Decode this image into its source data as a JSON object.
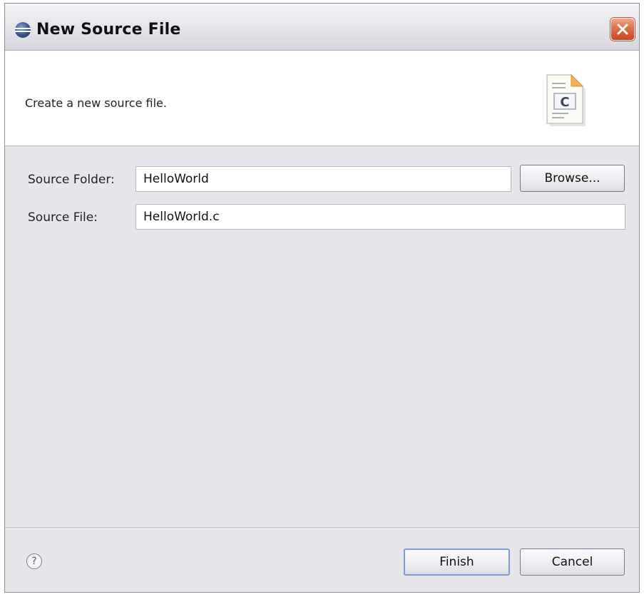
{
  "window": {
    "title": "New Source File",
    "app_icon": "eclipse-icon",
    "close_icon": "close-icon"
  },
  "banner": {
    "message": "Create a new source file.",
    "icon": "c-source-file-icon",
    "icon_letter": "C"
  },
  "form": {
    "source_folder": {
      "label": "Source Folder:",
      "value": "HelloWorld"
    },
    "source_file": {
      "label": "Source File:",
      "value": "HelloWorld.c"
    },
    "browse_label": "Browse..."
  },
  "footer": {
    "help_icon": "help-icon",
    "help_glyph": "?",
    "finish_label": "Finish",
    "cancel_label": "Cancel"
  },
  "colors": {
    "dialog_background": "#e8e6ea",
    "banner_background": "#ffffff",
    "close_button": "#d9583a",
    "default_button_border": "#7a9ad8"
  }
}
